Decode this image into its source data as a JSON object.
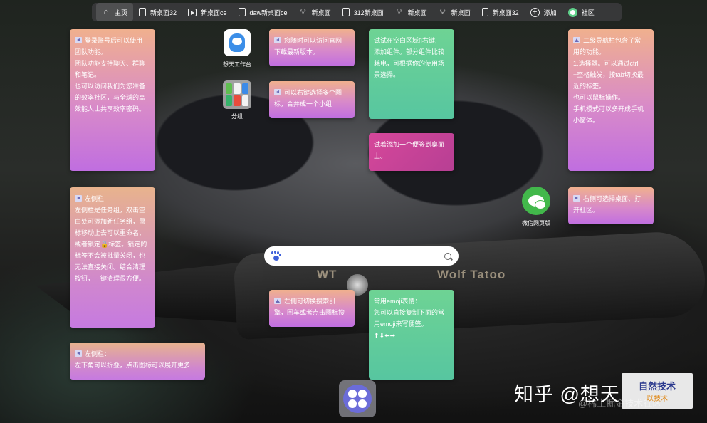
{
  "nav": {
    "items": [
      {
        "label": "主页",
        "icon": "home-icon",
        "active": true
      },
      {
        "label": "新桌面32",
        "icon": "page-icon"
      },
      {
        "label": "新桌面ce",
        "icon": "play-icon"
      },
      {
        "label": "daw新桌面ce",
        "icon": "doc-icon"
      },
      {
        "label": "新桌面",
        "icon": "bulb-icon"
      },
      {
        "label": "312新桌面",
        "icon": "page-icon"
      },
      {
        "label": "新桌面",
        "icon": "bulb-icon"
      },
      {
        "label": "新桌面",
        "icon": "bulb-icon"
      },
      {
        "label": "新桌面32",
        "icon": "phone-icon"
      },
      {
        "label": "添加",
        "icon": "plus-circle-icon"
      },
      {
        "label": "社区",
        "icon": "community-icon"
      }
    ]
  },
  "notes": {
    "login": [
      "登录账号后可以使用",
      "团队功能。",
      "团队功能支持聊天、群聊",
      "和笔记。",
      "也可以访问我们为您准备",
      "的效率社区，与全球的高",
      "效能人士共享效率密码。"
    ],
    "website": [
      "您随时可以访问官网",
      "下载最新版本。"
    ],
    "rightclick": [
      "可以右键选择多个图",
      "标，合并成一个小组"
    ],
    "blank": [
      "试试在空白区域▯右键,",
      "添加组件。部分组件比较",
      "耗电，可根据你的使用场",
      "景选择。"
    ],
    "addnote": [
      "试着添加一个便签到桌面",
      "上。"
    ],
    "secondnav": [
      "二级导航栏包含了常",
      "用的功能。",
      "1.选择器。可以通过ctrl",
      "+空格触发，按tab切换最",
      "近的标签。",
      "也可以鼠标操作。",
      "手机模式可以多开成手机",
      "小窗体。"
    ],
    "rightselect": [
      "右侧可选择桌面、打",
      "开社区。"
    ],
    "leftsidebar": [
      "左侧栏",
      "左侧栏是任务组，双击空",
      "白处可添加新任务组，鼠",
      "标移动上去可以重命名、",
      "或者锁定🔒标签。锁定的",
      "标签不会被批量关闭，也",
      "无法直接关闭。结合清理",
      "按钮，一键清理很方便。"
    ],
    "searchengine": [
      "左侧可切换搜索引",
      "擎，回车或者点击图标搜"
    ],
    "emoji": [
      "常用emoji表情：",
      "您可以直接复制下面的常",
      "用emoji来写便签。",
      "⬆⬇⬅➡"
    ],
    "leftbottom": [
      "左侧栏：",
      "左下角可以折叠，点击图标可以展开更多"
    ]
  },
  "apps": {
    "workbench": "想天工作台",
    "group": "分组",
    "wechat": "微信网页版"
  },
  "search": {
    "placeholder": "",
    "value": ""
  },
  "bg": {
    "knife_brand": "Wolf Tatoo",
    "knife_mark": "WT"
  },
  "watermark": {
    "main": "知乎 @想天",
    "sub": "@稀土掘金技术社区"
  },
  "corner_logo": {
    "line1": "自然技术",
    "line2": "以技术"
  }
}
